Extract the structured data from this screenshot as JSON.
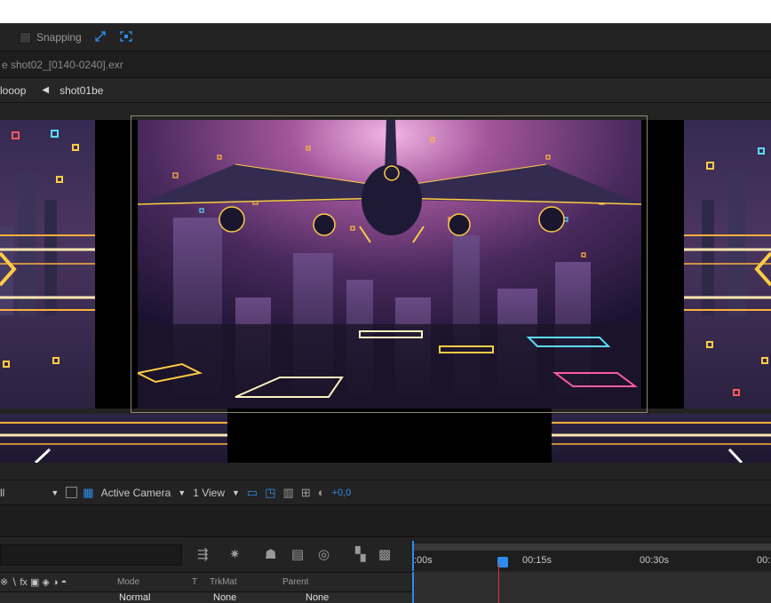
{
  "toolbar": {
    "snapping_label": "Snapping",
    "icons": [
      "snap-arrow-icon",
      "snap-expand-icon"
    ]
  },
  "tabbar": {
    "tab_label": "e  shot02_[0140-0240].exr"
  },
  "breadcrumb": {
    "items": [
      "looop",
      "shot01be"
    ]
  },
  "viewer_controls": {
    "resolution": "ll",
    "camera": "Active Camera",
    "view_layout": "1 View",
    "exposure_value": "+0,0"
  },
  "timeline": {
    "ruler_labels": [
      ":00s",
      "00:15s",
      "00:30s",
      "00:"
    ],
    "columns": {
      "mode": "Mode",
      "t": "T",
      "trkmat": "TrkMat",
      "parent": "Parent"
    },
    "layer_row": {
      "mode_value": "Normal",
      "trkmat_value": "None",
      "parent_value": "None"
    }
  },
  "colors": {
    "accent": "#2d8ceb",
    "playhead_line": "#e03030"
  }
}
